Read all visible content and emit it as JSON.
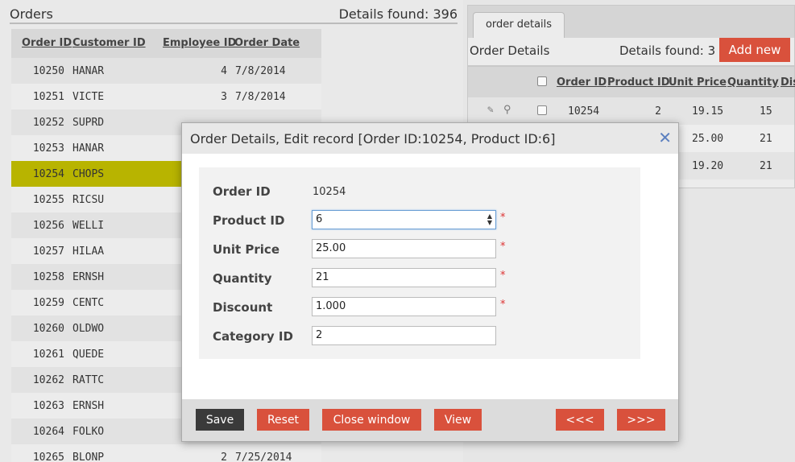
{
  "orders": {
    "title": "Orders",
    "found": "Details found: 396",
    "columns": [
      "Order ID",
      "Customer ID",
      "Employee ID",
      "Order Date"
    ],
    "rows": [
      {
        "id": "10250",
        "cust": "HANAR",
        "emp": "4",
        "date": "7/8/2014"
      },
      {
        "id": "10251",
        "cust": "VICTE",
        "emp": "3",
        "date": "7/8/2014"
      },
      {
        "id": "10252",
        "cust": "SUPRD",
        "emp": "",
        "date": ""
      },
      {
        "id": "10253",
        "cust": "HANAR",
        "emp": "",
        "date": ""
      },
      {
        "id": "10254",
        "cust": "CHOPS",
        "emp": "",
        "date": ""
      },
      {
        "id": "10255",
        "cust": "RICSU",
        "emp": "",
        "date": ""
      },
      {
        "id": "10256",
        "cust": "WELLI",
        "emp": "",
        "date": ""
      },
      {
        "id": "10257",
        "cust": "HILAA",
        "emp": "",
        "date": ""
      },
      {
        "id": "10258",
        "cust": "ERNSH",
        "emp": "",
        "date": ""
      },
      {
        "id": "10259",
        "cust": "CENTC",
        "emp": "",
        "date": ""
      },
      {
        "id": "10260",
        "cust": "OLDWO",
        "emp": "",
        "date": ""
      },
      {
        "id": "10261",
        "cust": "QUEDE",
        "emp": "",
        "date": ""
      },
      {
        "id": "10262",
        "cust": "RATTC",
        "emp": "",
        "date": ""
      },
      {
        "id": "10263",
        "cust": "ERNSH",
        "emp": "",
        "date": ""
      },
      {
        "id": "10264",
        "cust": "FOLKO",
        "emp": "",
        "date": ""
      },
      {
        "id": "10265",
        "cust": "BLONP",
        "emp": "2",
        "date": "7/25/2014"
      }
    ],
    "selected_id": "10254",
    "selected_color": "#b8b400"
  },
  "details": {
    "tab": "order details",
    "title": "Order Details",
    "found": "Details found: 3",
    "add_label": "Add new",
    "columns": [
      "Order ID",
      "Product ID",
      "Unit Price",
      "Quantity",
      "Dis"
    ],
    "rows": [
      {
        "order": "10254",
        "product": "2",
        "price": "19.15",
        "qty": "15"
      },
      {
        "order": "",
        "product": "",
        "price": "25.00",
        "qty": "21"
      },
      {
        "order": "",
        "product": "",
        "price": "19.20",
        "qty": "21"
      }
    ]
  },
  "modal": {
    "title": "Order Details, Edit record [Order ID:10254, Product ID:6]",
    "close_icon": "close-icon",
    "fields": {
      "order_id_label": "Order ID",
      "order_id_value": "10254",
      "product_label": "Product ID",
      "product_value": "6",
      "price_label": "Unit Price",
      "price_value": "25.00",
      "qty_label": "Quantity",
      "qty_value": "21",
      "discount_label": "Discount",
      "discount_value": "1.000",
      "category_label": "Category ID",
      "category_value": "2",
      "required_mark": "*"
    },
    "buttons": {
      "save": "Save",
      "reset": "Reset",
      "close": "Close window",
      "view": "View",
      "prev": "<<<",
      "next": ">>>"
    }
  },
  "colors": {
    "accent": "#d9513c",
    "save": "#3a3a3a"
  }
}
